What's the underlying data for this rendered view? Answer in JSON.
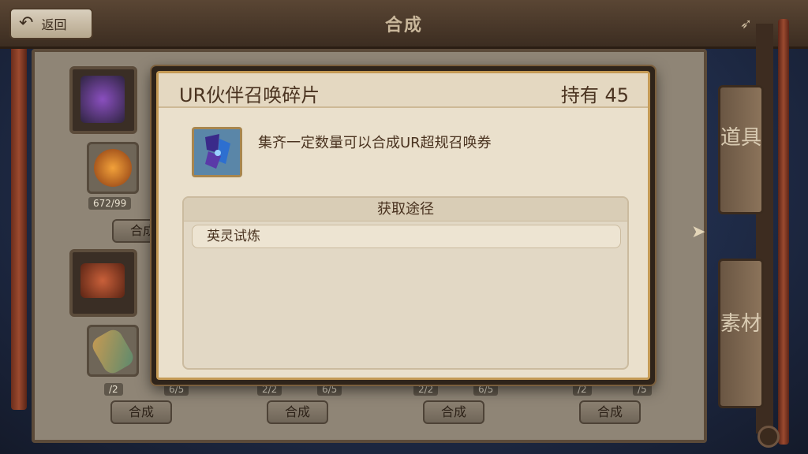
{
  "header": {
    "back_label": "返回",
    "title": "合成"
  },
  "inventory": {
    "counts": [
      "672/99",
      "/2",
      "6/5",
      "2/2",
      "6/5",
      "2/2",
      "6/5",
      "/2",
      "/5"
    ],
    "synth_label": "合成"
  },
  "side_tabs": {
    "items": "道具",
    "materials": "素材"
  },
  "modal": {
    "item_name": "UR伙伴召唤碎片",
    "held": "持有 45",
    "description": "集齐一定数量可以合成UR超规召唤券",
    "obtain_title": "获取途径",
    "sources": [
      "英灵试炼"
    ]
  }
}
